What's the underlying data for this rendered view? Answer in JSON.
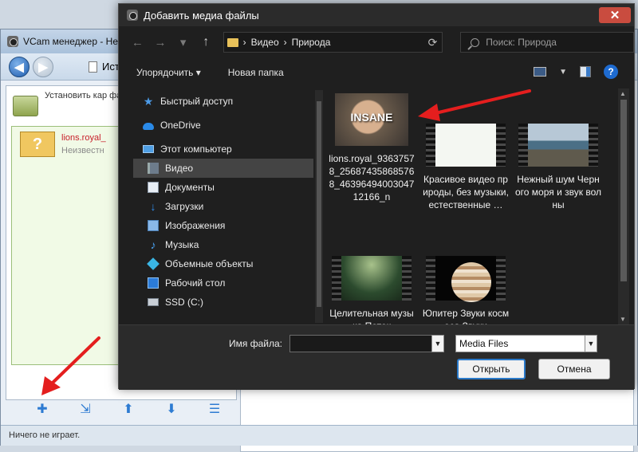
{
  "bg_window": {
    "title": "VCam менеджер - Не",
    "history_label": "Исто",
    "info_text": "Установить кар файлы в качест VCAM",
    "item_title": "lions.royal_",
    "item_subtitle": "Неизвестн",
    "item_icon_glyph": "?",
    "status": "Ничего не играет."
  },
  "dialog": {
    "title": "Добавить медиа файлы",
    "close_glyph": "✕",
    "address": {
      "crumb1": "Видео",
      "crumb2": "Природа"
    },
    "search_placeholder": "Поиск: Природа",
    "toolbar": {
      "organize": "Упорядочить ▾",
      "new_folder": "Новая папка",
      "help": "?"
    },
    "nav": [
      {
        "label": "Быстрый доступ",
        "icon": "star-icon"
      },
      {
        "label": "OneDrive",
        "icon": "cloud-icon"
      },
      {
        "label": "Этот компьютер",
        "icon": "computer-icon"
      },
      {
        "label": "Видео",
        "icon": "video-folder-icon"
      },
      {
        "label": "Документы",
        "icon": "documents-icon"
      },
      {
        "label": "Загрузки",
        "icon": "downloads-icon"
      },
      {
        "label": "Изображения",
        "icon": "pictures-icon"
      },
      {
        "label": "Музыка",
        "icon": "music-icon"
      },
      {
        "label": "Объемные объекты",
        "icon": "3d-objects-icon"
      },
      {
        "label": "Рабочий стол",
        "icon": "desktop-icon"
      },
      {
        "label": "SSD (C:)",
        "icon": "drive-icon"
      }
    ],
    "files": [
      {
        "label": "lions.royal_93637578_256874358685768_4639649400304712166_n",
        "thumb_text": "INSANE"
      },
      {
        "label": "Красивое видео природы, без музыки, естественные …"
      },
      {
        "label": "Нежный шум Черного моря и звук волны"
      },
      {
        "label": "Целительная музыка Поток"
      },
      {
        "label": "Юпитер Звуки космоса Звуки"
      }
    ],
    "filename_label": "Имя файла:",
    "filename_value": "",
    "filter_value": "Media Files",
    "open_button": "Открыть",
    "cancel_button": "Отмена"
  },
  "colors": {
    "dialog_bg": "#1f1f1f",
    "accent": "#2a79c9",
    "close": "#c94c3f",
    "annotation_arrow": "#e41e1e"
  }
}
